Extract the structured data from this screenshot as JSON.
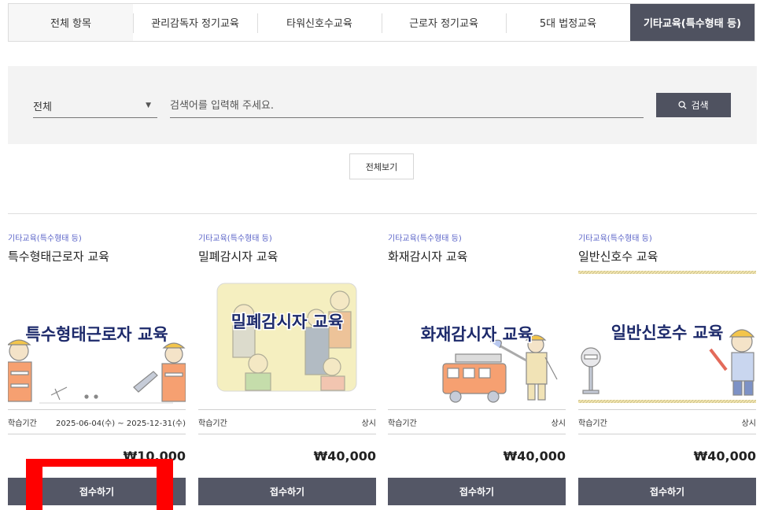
{
  "tabs": [
    {
      "label": "전체 항목"
    },
    {
      "label": "관리감독자 정기교육"
    },
    {
      "label": "타워신호수교육"
    },
    {
      "label": "근로자 정기교육"
    },
    {
      "label": "5대 법정교육"
    },
    {
      "label": "기타교육(특수형태 등)"
    }
  ],
  "search": {
    "select_value": "전체",
    "placeholder": "검색어를 입력해 주세요.",
    "button_label": "검색"
  },
  "view_all_label": "전체보기",
  "cards": [
    {
      "category": "기타교육(특수형태 등)",
      "title": "특수형태근로자 교육",
      "thumb_text": "특수형태근로자 교육",
      "period_label": "학습기간",
      "period_value": "2025-06-04(수) ~ 2025-12-31(수)",
      "price": "₩10,000",
      "apply_label": "접수하기"
    },
    {
      "category": "기타교육(특수형태 등)",
      "title": "밀폐감시자 교육",
      "thumb_text": "밀폐감시자 교육",
      "period_label": "학습기간",
      "period_value": "상시",
      "price": "₩40,000",
      "apply_label": "접수하기"
    },
    {
      "category": "기타교육(특수형태 등)",
      "title": "화재감시자 교육",
      "thumb_text": "화재감시자 교육",
      "period_label": "학습기간",
      "period_value": "상시",
      "price": "₩40,000",
      "apply_label": "접수하기"
    },
    {
      "category": "기타교육(특수형태 등)",
      "title": "일반신호수 교육",
      "thumb_text": "일반신호수 교육",
      "period_label": "학습기간",
      "period_value": "상시",
      "price": "₩40,000",
      "apply_label": "접수하기"
    }
  ],
  "colors": {
    "accent": "#4f5260",
    "category": "#5b64c8",
    "highlight": "#ff0000"
  }
}
